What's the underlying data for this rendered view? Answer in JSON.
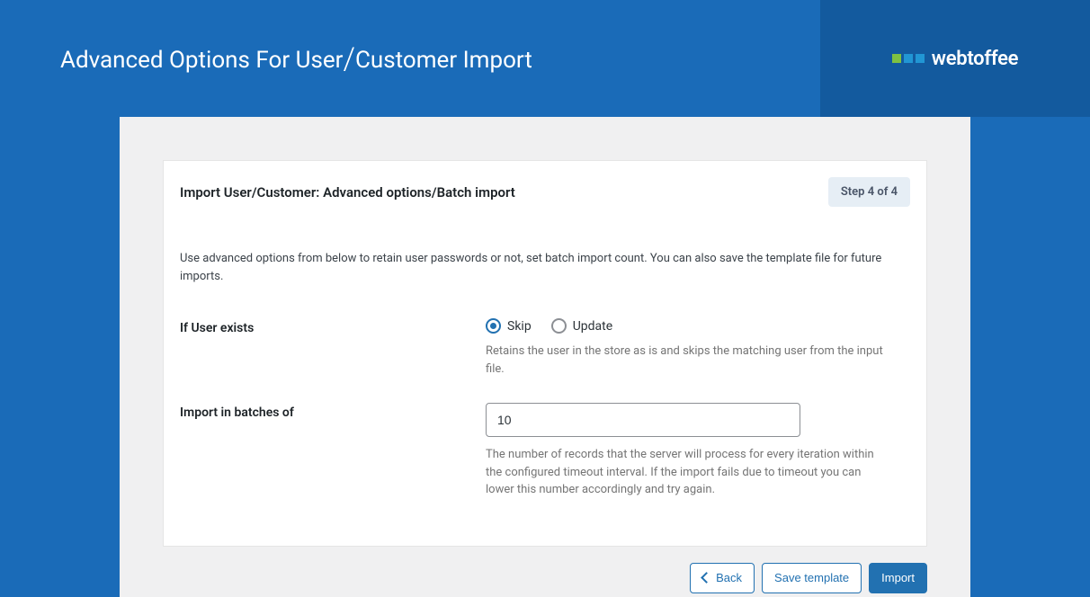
{
  "header": {
    "title_left": "Advanced Options For User",
    "title_right": "Customer Import",
    "brand": "webtoffee"
  },
  "panel": {
    "heading": "Import User/Customer: Advanced options/Batch import",
    "step_badge": "Step 4 of 4",
    "description": "Use advanced options from below to retain user passwords or not, set batch import count. You can also save the template file for future imports."
  },
  "form": {
    "user_exists": {
      "label": "If User exists",
      "options": {
        "skip": "Skip",
        "update": "Update"
      },
      "help": "Retains the user in the store as is and skips the matching user from the input file."
    },
    "batch_size": {
      "label": "Import in batches of",
      "value": "10",
      "help": "The number of records that the server will process for every iteration within the configured timeout interval. If the import fails due to timeout you can lower this number accordingly and try again."
    }
  },
  "footer": {
    "back": "Back",
    "save_template": "Save template",
    "import": "Import"
  }
}
